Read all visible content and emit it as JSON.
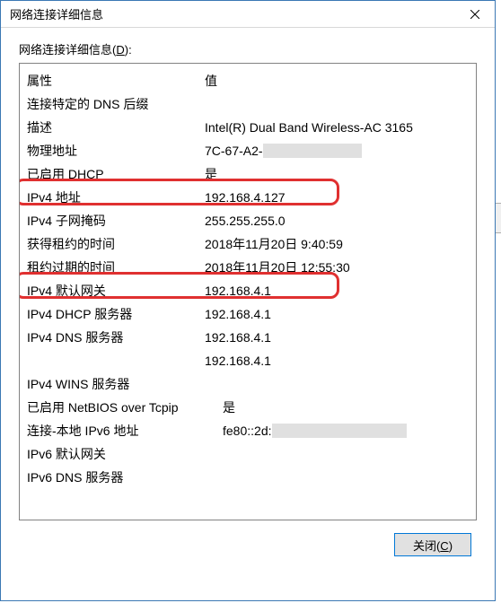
{
  "window": {
    "title": "网络连接详细信息"
  },
  "section_label": {
    "text": "网络连接详细信息(",
    "hotkey": "D",
    "suffix": "):"
  },
  "headers": {
    "property": "属性",
    "value": "值"
  },
  "rows": {
    "r0": {
      "prop": "连接特定的 DNS 后缀",
      "val": ""
    },
    "r1": {
      "prop": "描述",
      "val": "Intel(R) Dual Band Wireless-AC 3165"
    },
    "r2": {
      "prop": "物理地址",
      "val": "7C-67-A2-"
    },
    "r3": {
      "prop": "已启用 DHCP",
      "val": "是"
    },
    "r4": {
      "prop": "IPv4 地址",
      "val": "192.168.4.127"
    },
    "r5": {
      "prop": "IPv4 子网掩码",
      "val": "255.255.255.0"
    },
    "r6": {
      "prop": "获得租约的时间",
      "val": "2018年11月20日 9:40:59"
    },
    "r7": {
      "prop": "租约过期的时间",
      "val": "2018年11月20日 12:55:30"
    },
    "r8": {
      "prop": "IPv4 默认网关",
      "val": "192.168.4.1"
    },
    "r9": {
      "prop": "IPv4 DHCP 服务器",
      "val": "192.168.4.1"
    },
    "r10": {
      "prop": "IPv4 DNS 服务器",
      "val": "192.168.4.1"
    },
    "r11": {
      "prop": "",
      "val": "192.168.4.1"
    },
    "r12": {
      "prop": "IPv4 WINS 服务器",
      "val": ""
    },
    "r13": {
      "prop": "已启用 NetBIOS over Tcpip",
      "val": "是"
    },
    "r14": {
      "prop": "连接-本地 IPv6 地址",
      "val": "fe80::2d:"
    },
    "r15": {
      "prop": "IPv6 默认网关",
      "val": ""
    },
    "r16": {
      "prop": "IPv6 DNS 服务器",
      "val": ""
    }
  },
  "buttons": {
    "close_prefix": "关闭(",
    "close_hotkey": "C",
    "close_suffix": ")"
  },
  "colors": {
    "highlight": "#e03030",
    "border": "#3b78b4",
    "button_focus": "#0078d7"
  }
}
